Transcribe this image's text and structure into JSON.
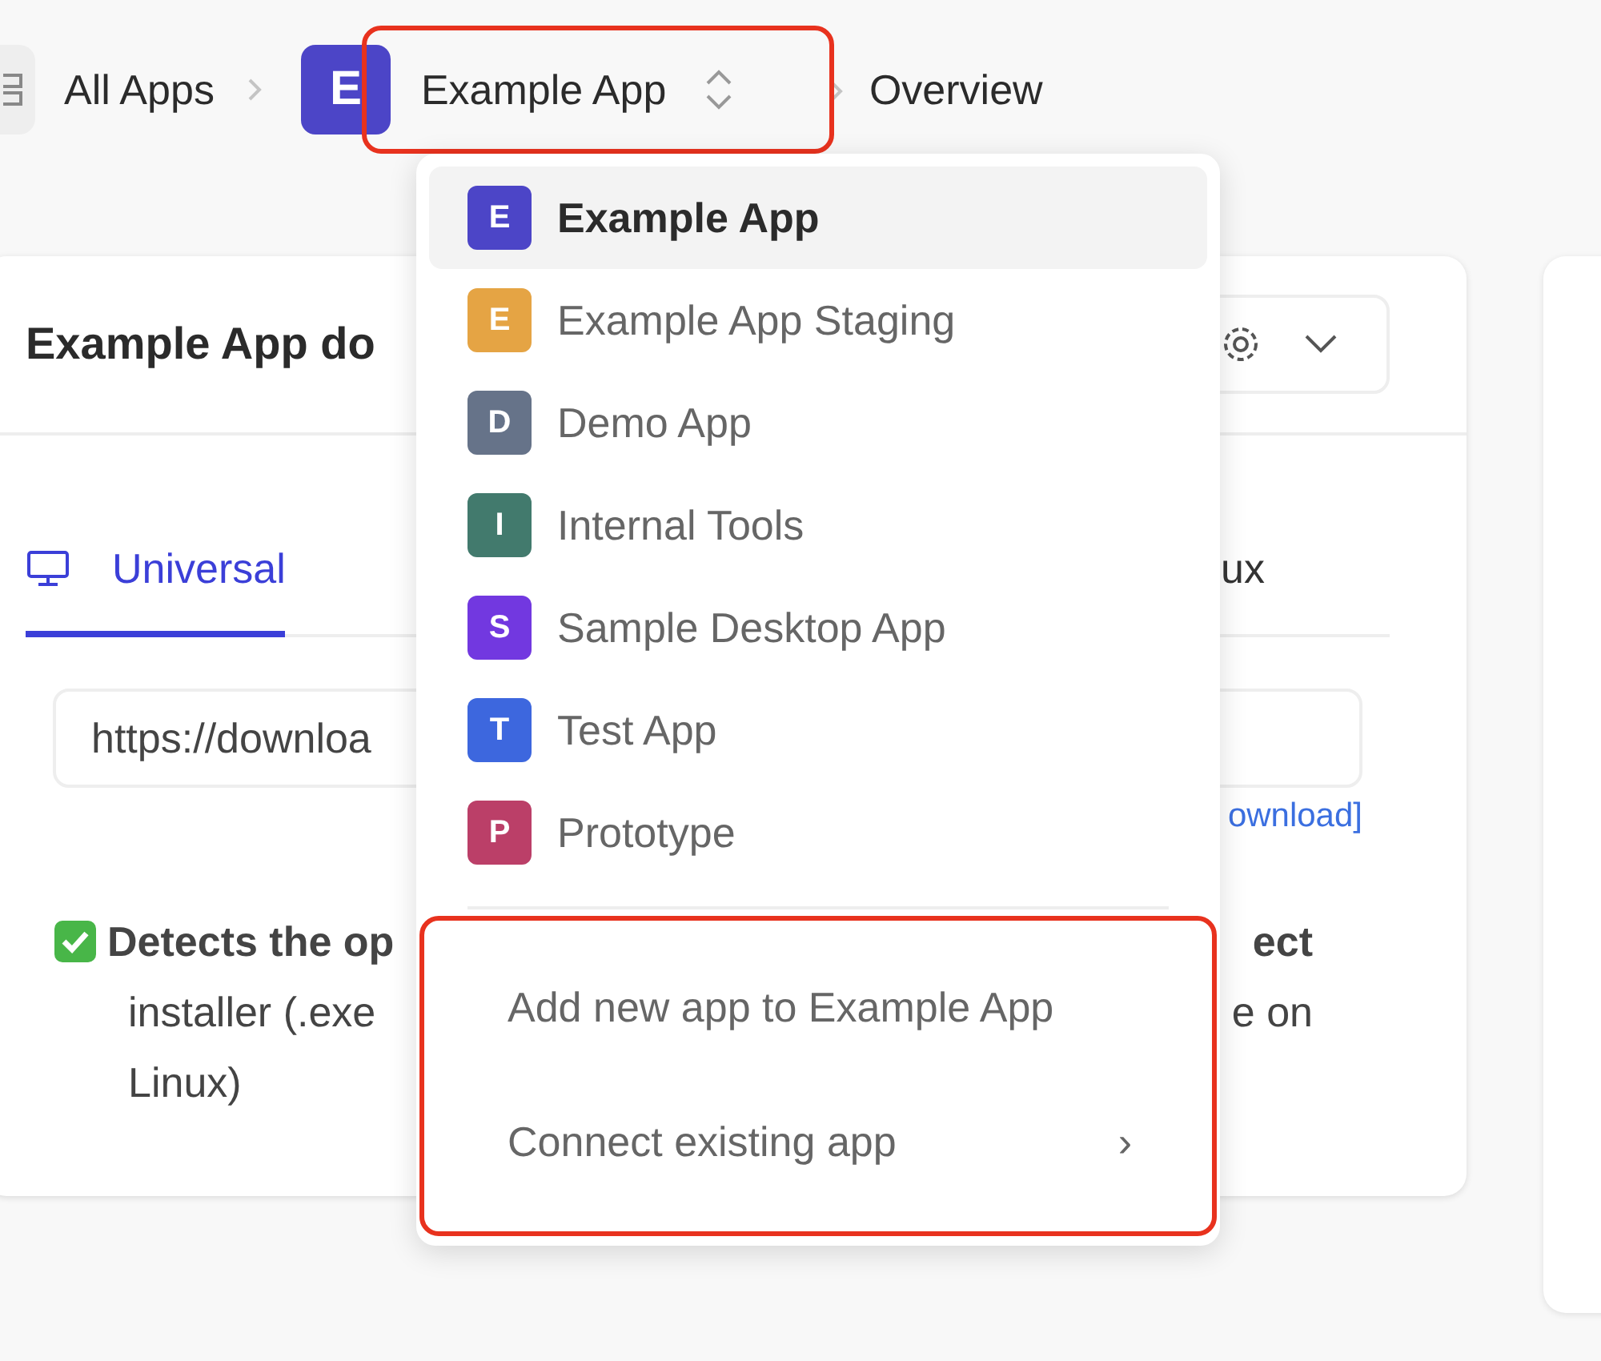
{
  "breadcrumbs": {
    "home": {
      "label": "All Apps"
    },
    "app_switcher": {
      "badge": "E",
      "color": "#4c45c7",
      "label": "Example App",
      "highlighted": true
    },
    "current": "Overview"
  },
  "card": {
    "title": "Example App do",
    "tabs": [
      {
        "label": "Universal",
        "selected": true
      },
      {
        "label": "ux",
        "selected": false
      }
    ],
    "url_field": {
      "value": "https://downloa"
    },
    "link": "ownload]",
    "feature_lines": [
      {
        "left": "Detects the op",
        "right": "ect",
        "bold": true
      },
      {
        "left": "installer (.exe",
        "right": "e on",
        "bold": false
      },
      {
        "left": "Linux)",
        "bold": false
      }
    ]
  },
  "app_menu": {
    "items": [
      {
        "badge": "E",
        "label": "Example App",
        "color": "#4c45c7",
        "selected": true
      },
      {
        "badge": "E",
        "label": "Example App Staging",
        "color": "#e5a444",
        "selected": false
      },
      {
        "badge": "D",
        "label": "Demo App",
        "color": "#667389",
        "selected": false
      },
      {
        "badge": "I",
        "label": "Internal Tools",
        "color": "#427a6d",
        "selected": false
      },
      {
        "badge": "S",
        "label": "Sample Desktop App",
        "color": "#7238e0",
        "selected": false
      },
      {
        "badge": "T",
        "label": "Test App",
        "color": "#3d67de",
        "selected": false
      },
      {
        "badge": "P",
        "label": "Prototype",
        "color": "#bb3f68",
        "selected": false
      }
    ],
    "actions": [
      {
        "label": "Add new app to Example App"
      },
      {
        "label": "Connect existing app",
        "submenu_mark": "›"
      }
    ],
    "actions_highlighted": true
  }
}
